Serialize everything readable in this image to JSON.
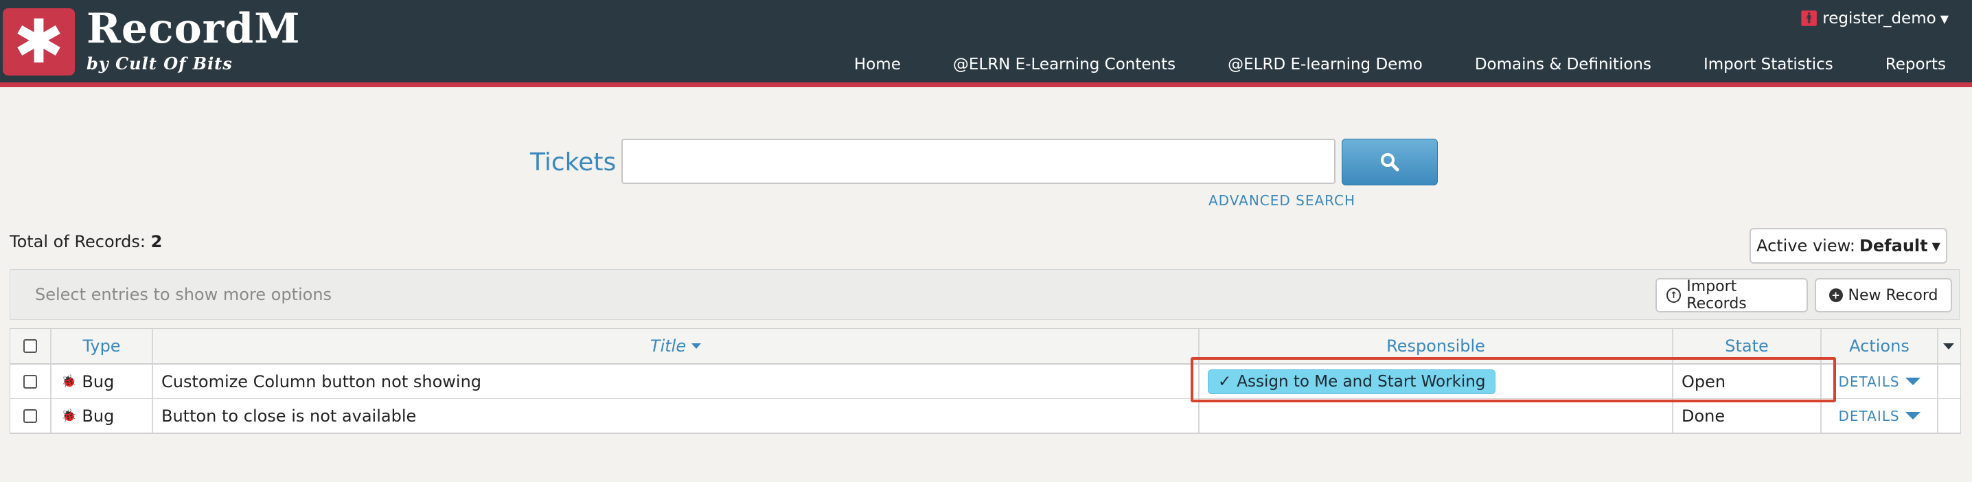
{
  "header": {
    "logo_symbol": "✱",
    "brand_name": "RecordM",
    "brand_sub": "by Cult Of Bits",
    "user": "register_demo",
    "nav": [
      "Home",
      "@ELRN E-Learning Contents",
      "@ELRD E-learning Demo",
      "Domains & Definitions",
      "Import Statistics",
      "Reports"
    ]
  },
  "search": {
    "title": "Tickets",
    "value": "",
    "advanced": "ADVANCED SEARCH"
  },
  "records": {
    "total_label": "Total of Records:",
    "total_count": "2",
    "active_view_label": "Active view:",
    "active_view_value": "Default",
    "options_hint": "Select entries to show more options",
    "import_label": "Import Records",
    "new_label": "New Record"
  },
  "table": {
    "headers": {
      "type": "Type",
      "title": "Title",
      "responsible": "Responsible",
      "state": "State",
      "actions": "Actions"
    },
    "rows": [
      {
        "type": "Bug",
        "title": "Customize Column button not showing",
        "responsible_action": "Assign to Me and Start Working",
        "state": "Open",
        "details": "DETAILS"
      },
      {
        "type": "Bug",
        "title": "Button to close is not available",
        "responsible_action": "",
        "state": "Done",
        "details": "DETAILS"
      }
    ]
  },
  "colors": {
    "header_bg": "#2b3a42",
    "accent_red": "#c8374a",
    "link_blue": "#3b88bd",
    "assign_button": "#7ad5ef",
    "highlight_border": "#d6432f"
  },
  "icons": {
    "logo": "asterisk-icon",
    "user": "user-icon",
    "search": "magnifier-icon",
    "import": "upload-circle-icon",
    "new": "plus-circle-icon",
    "bug": "bug-icon",
    "check": "checkmark-icon"
  }
}
